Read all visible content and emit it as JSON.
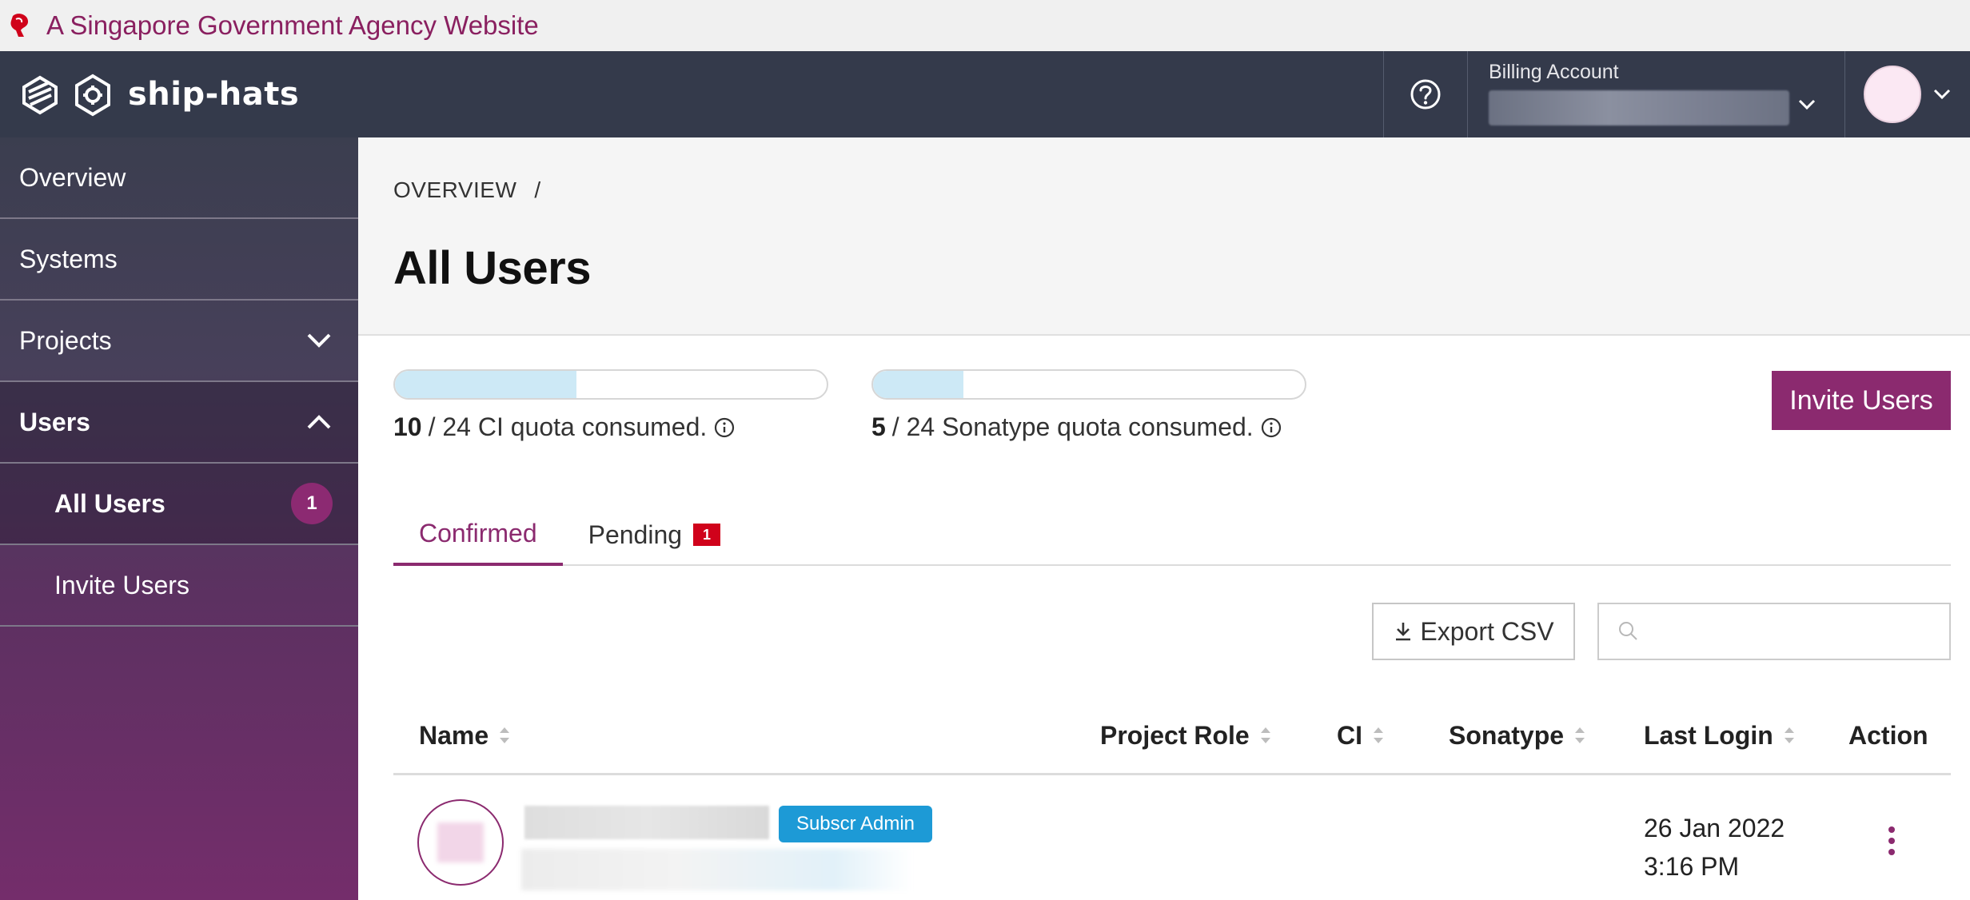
{
  "masthead": {
    "text": "A Singapore Government Agency Website"
  },
  "header": {
    "brand": "ship-hats",
    "billing_label": "Billing Account"
  },
  "sidebar": {
    "items": [
      {
        "label": "Overview"
      },
      {
        "label": "Systems"
      },
      {
        "label": "Projects"
      },
      {
        "label": "Users"
      },
      {
        "label": "All Users",
        "badge": "1"
      },
      {
        "label": "Invite Users"
      }
    ]
  },
  "main": {
    "breadcrumb": "OVERVIEW",
    "breadcrumb_sep": "/",
    "title": "All Users",
    "quotas": [
      {
        "used": "10",
        "rest": "/ 24 CI quota consumed.",
        "fraction": 0.42
      },
      {
        "used": "5",
        "rest": "/ 24 Sonatype quota consumed.",
        "fraction": 0.21
      }
    ],
    "invite_button": "Invite Users",
    "tabs": [
      {
        "label": "Confirmed"
      },
      {
        "label": "Pending",
        "badge": "1"
      }
    ],
    "export_button": "Export CSV",
    "search_placeholder": "",
    "columns": [
      "Name",
      "Project Role",
      "CI",
      "Sonatype",
      "Last Login",
      "Action"
    ],
    "rows": [
      {
        "role_badge": "Subscr Admin",
        "last_login_date": "26 Jan 2022",
        "last_login_time": "3:16 PM"
      }
    ]
  },
  "colors": {
    "brand": "#8b2a6f",
    "header_bg": "#343a4b",
    "quota_fill": "#cde9f6",
    "pending_badge": "#d0021b",
    "role_badge": "#1d9ad6"
  }
}
